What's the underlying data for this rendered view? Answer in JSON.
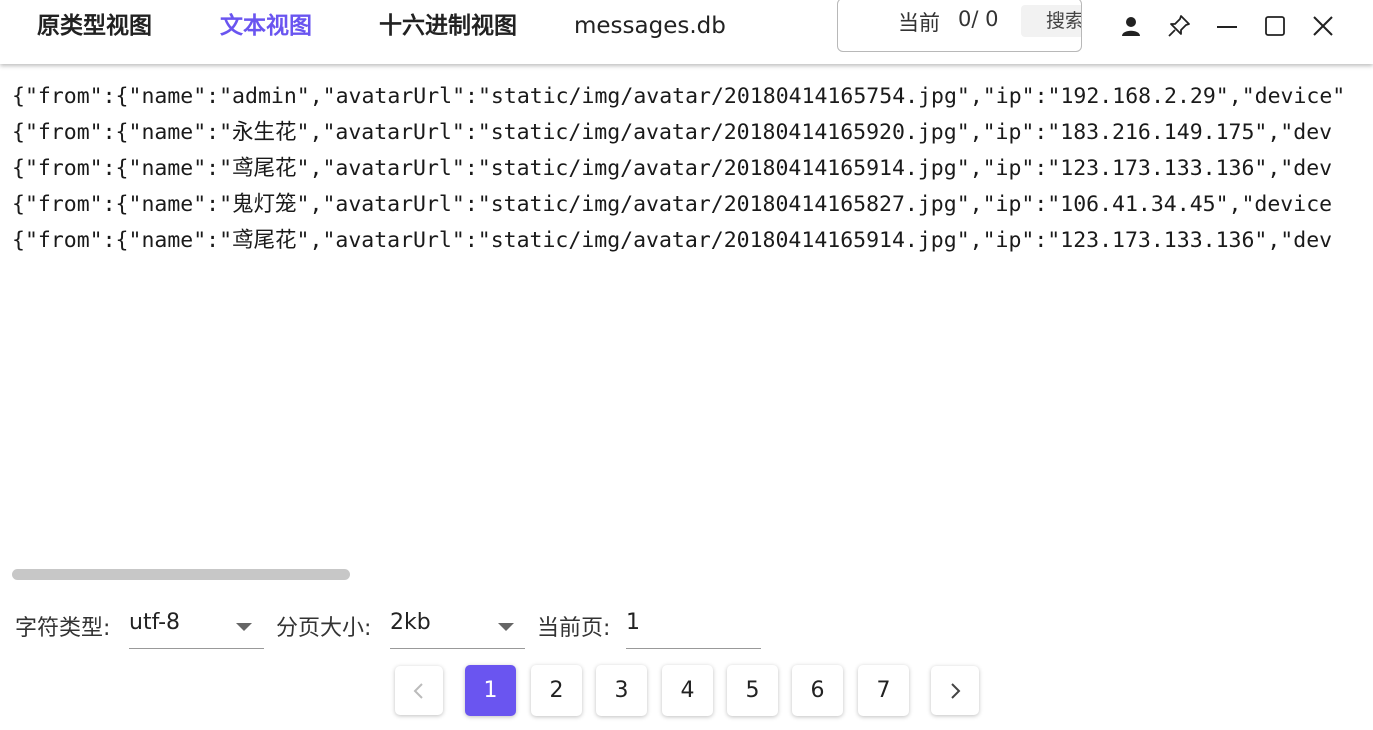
{
  "header": {
    "tabs": [
      {
        "label": "原类型视图",
        "active": false
      },
      {
        "label": "文本视图",
        "active": true
      },
      {
        "label": "十六进制视图",
        "active": false
      }
    ],
    "filename": "messages.db",
    "search": {
      "label": "当前",
      "count": "0/ 0",
      "button_label": "搜索"
    },
    "icons": [
      "user-icon",
      "pin-icon",
      "minimize-icon",
      "maximize-icon",
      "close-icon"
    ]
  },
  "content": {
    "lines": [
      "{\"from\":{\"name\":\"admin\",\"avatarUrl\":\"static/img/avatar/20180414165754.jpg\",\"ip\":\"192.168.2.29\",\"device\"",
      "{\"from\":{\"name\":\"永生花\",\"avatarUrl\":\"static/img/avatar/20180414165920.jpg\",\"ip\":\"183.216.149.175\",\"dev",
      "{\"from\":{\"name\":\"鸢尾花\",\"avatarUrl\":\"static/img/avatar/20180414165914.jpg\",\"ip\":\"123.173.133.136\",\"dev",
      "{\"from\":{\"name\":\"鬼灯笼\",\"avatarUrl\":\"static/img/avatar/20180414165827.jpg\",\"ip\":\"106.41.34.45\",\"device",
      "{\"from\":{\"name\":\"鸢尾花\",\"avatarUrl\":\"static/img/avatar/20180414165914.jpg\",\"ip\":\"123.173.133.136\",\"dev"
    ]
  },
  "settings": {
    "charset_label": "字符类型:",
    "charset_value": "utf-8",
    "pagesize_label": "分页大小:",
    "pagesize_value": "2kb",
    "current_page_label": "当前页:",
    "current_page_value": "1"
  },
  "pagination": {
    "pages": [
      "1",
      "2",
      "3",
      "4",
      "5",
      "6",
      "7"
    ],
    "active_page": "1"
  },
  "colors": {
    "accent": "#6a55f0"
  }
}
